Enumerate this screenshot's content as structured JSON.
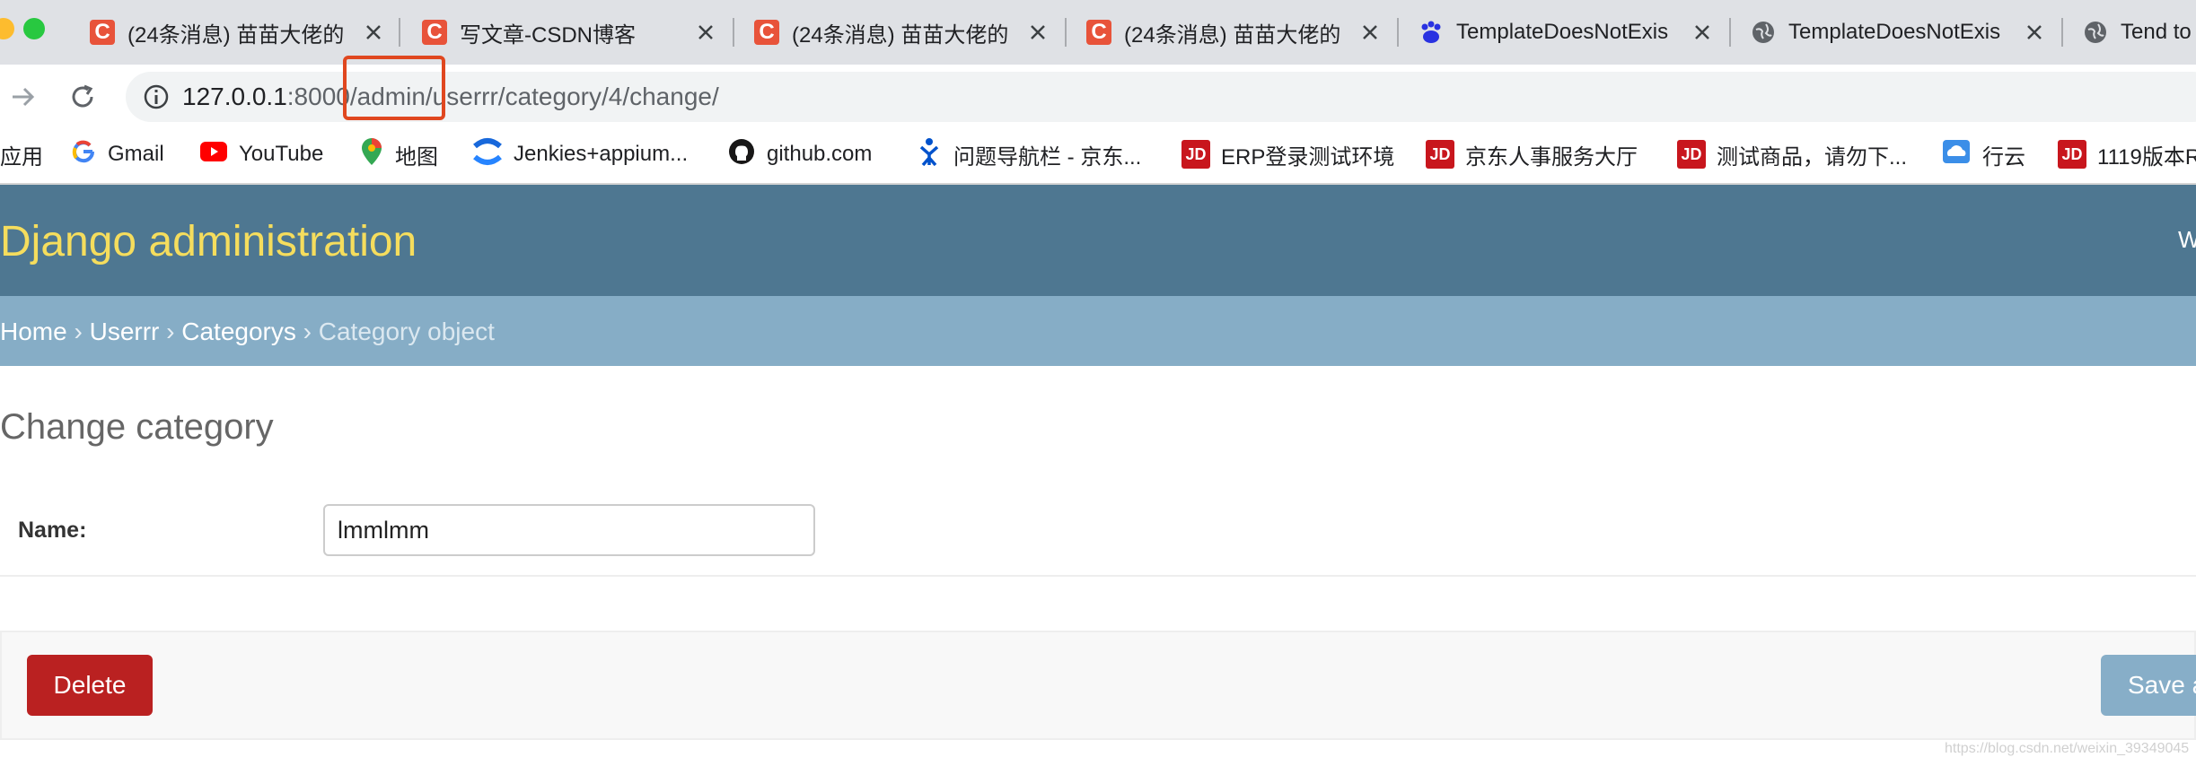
{
  "browser": {
    "tabs": [
      {
        "title": "(24条消息) 苗苗大佬的",
        "icon": "csdn-icon",
        "close": "×"
      },
      {
        "title": "写文章-CSDN博客",
        "icon": "csdn-icon",
        "close": "×"
      },
      {
        "title": "(24条消息) 苗苗大佬的",
        "icon": "csdn-icon",
        "close": "×"
      },
      {
        "title": "(24条消息) 苗苗大佬的",
        "icon": "csdn-icon",
        "close": "×"
      },
      {
        "title": "TemplateDoesNotExis",
        "icon": "baidu-icon",
        "close": "×"
      },
      {
        "title": "TemplateDoesNotExis",
        "icon": "globe-icon",
        "close": "×"
      },
      {
        "title": "Tend to",
        "icon": "globe-icon"
      }
    ],
    "url_host": "127.0.0.1",
    "url_port": ":8000",
    "url_path": "/admin/userrr/category/4/change/",
    "bookmarks": [
      {
        "label": "应用",
        "icon": ""
      },
      {
        "label": "Gmail",
        "icon": "google-icon"
      },
      {
        "label": "YouTube",
        "icon": "youtube-icon"
      },
      {
        "label": "地图",
        "icon": "maps-pin-icon"
      },
      {
        "label": "Jenkies+appium...",
        "icon": "confluence-icon"
      },
      {
        "label": "github.com",
        "icon": "github-icon"
      },
      {
        "label": "问题导航栏 - 京东...",
        "icon": "jira-icon"
      },
      {
        "label": "ERP登录测试环境",
        "icon": "jd-icon"
      },
      {
        "label": "京东人事服务大厅",
        "icon": "jd-icon"
      },
      {
        "label": "测试商品，请勿下...",
        "icon": "jd-icon"
      },
      {
        "label": "行云",
        "icon": "cloud-icon"
      },
      {
        "label": "1119版本R",
        "icon": "jd-icon"
      }
    ],
    "jd_text": "JD",
    "csdn_letter": "C"
  },
  "admin": {
    "site_title": "Django administration",
    "user_initial": "W",
    "breadcrumbs": [
      "Home",
      "Userrr",
      "Categorys",
      "Category object"
    ],
    "breadcrumb_sep": "›",
    "page_title": "Change category",
    "name_label": "Name:",
    "name_value": "lmmlmm",
    "delete_label": "Delete",
    "save_label": "Save a"
  },
  "watermark": "https://blog.csdn.net/weixin_39349045",
  "colors": {
    "header_bg": "#4e7791",
    "branding": "#f5dd5d",
    "breadcrumb_bg": "#86adc6",
    "delete_bg": "#ba2121",
    "save_bg": "#87aec8",
    "highlight": "#e0471f"
  }
}
